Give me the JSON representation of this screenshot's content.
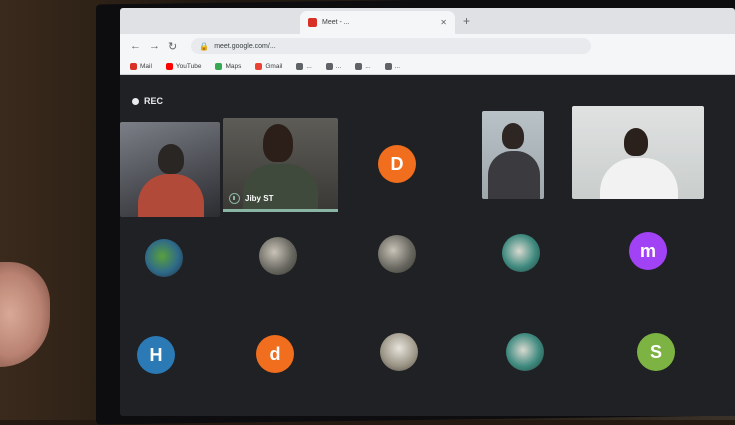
{
  "browser": {
    "tab_title": "Meet - ...",
    "url": "meet.google.com/...",
    "bookmarks": [
      {
        "label": "Mail",
        "color": "#d93025"
      },
      {
        "label": "YouTube",
        "color": "#ff0000"
      },
      {
        "label": "Maps",
        "color": "#34a853"
      },
      {
        "label": "Gmail",
        "color": "#ea4335"
      },
      {
        "label": "...",
        "color": "#5f6368"
      },
      {
        "label": "...",
        "color": "#5f6368"
      },
      {
        "label": "...",
        "color": "#5f6368"
      },
      {
        "label": "...",
        "color": "#5f6368"
      }
    ]
  },
  "meeting": {
    "recording_label": "REC",
    "speaker_name": "Jiby ST",
    "participants_row1": [
      {
        "initial": "D",
        "color": "#f06e1d"
      }
    ],
    "participants_row2": [
      {
        "initial": "",
        "style": "g"
      },
      {
        "initial": "",
        "style": "photo"
      },
      {
        "initial": "",
        "style": "photo"
      },
      {
        "initial": "",
        "style": "t"
      },
      {
        "initial": "m",
        "color": "#a142f4"
      }
    ],
    "participants_row3": [
      {
        "initial": "H",
        "color": "#2b7ab5"
      },
      {
        "initial": "d",
        "color": "#f06e1d"
      },
      {
        "initial": "",
        "style": "s"
      },
      {
        "initial": "",
        "style": "t"
      },
      {
        "initial": "S",
        "color": "#7cb342"
      }
    ]
  },
  "colors": {
    "meet_background": "#202124",
    "speaking_indicator": "#8ab4a4"
  }
}
